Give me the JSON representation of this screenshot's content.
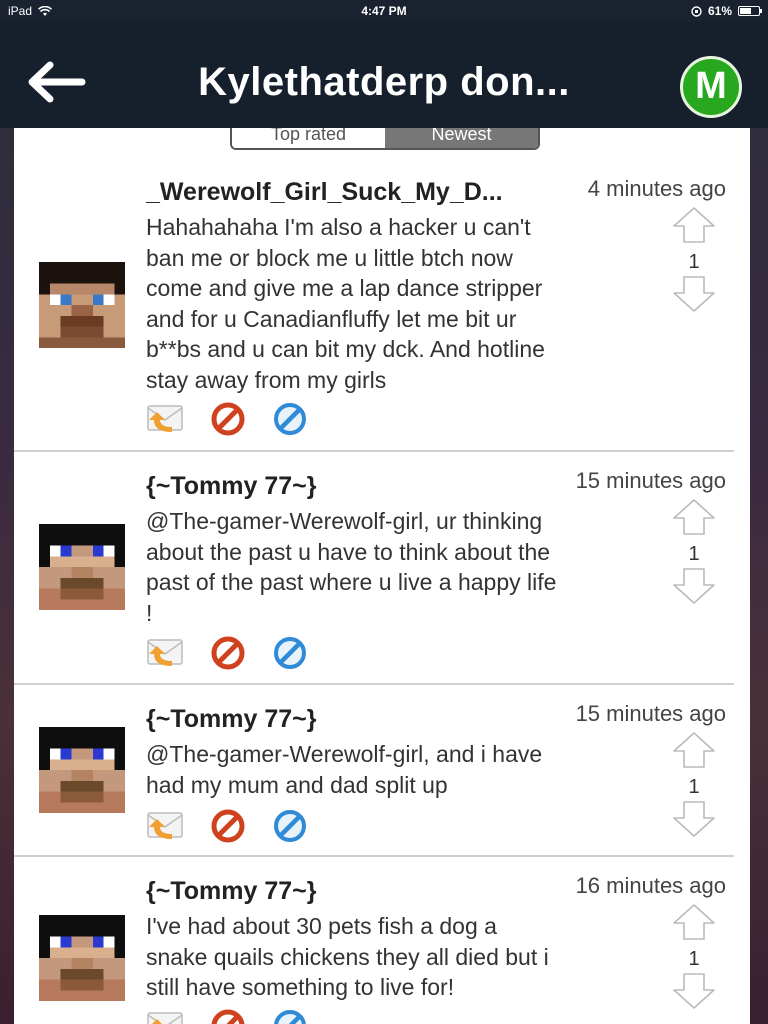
{
  "status": {
    "device": "iPad",
    "time": "4:47 PM",
    "battery": "61%"
  },
  "nav": {
    "title": "Kylethatderp don...",
    "logo_letter": "M"
  },
  "tabs": {
    "top_rated": "Top rated",
    "newest": "Newest"
  },
  "comments": [
    {
      "username": "_Werewolf_Girl_Suck_My_D...",
      "time": "4 minutes ago",
      "lines": [
        "Hahahahaha I'm also a hacker u can't",
        "ban me or block me u little btch now",
        "come and give me a lap dance stripper",
        "and for u Canadianfluffy let me bit ur",
        "b**bs and u can bit my dck. And hotline",
        "stay away from my girls"
      ],
      "votes": "1"
    },
    {
      "username": "{~Tommy 77~}",
      "time": "15 minutes ago",
      "lines": [
        "@The-gamer-Werewolf-girl, ur thinking",
        "about the past u have to think about the",
        "past of the past where u live a happy life",
        "!"
      ],
      "votes": "1"
    },
    {
      "username": "{~Tommy 77~}",
      "time": "15 minutes ago",
      "lines": [
        "@The-gamer-Werewolf-girl, and i have",
        "had my mum and dad split up"
      ],
      "votes": "1"
    },
    {
      "username": "{~Tommy 77~}",
      "time": "16 minutes ago",
      "lines": [
        "I've had about 30 pets fish a dog a",
        "snake quails chickens they all died but i",
        "still have something to live for!"
      ],
      "votes": "1"
    }
  ],
  "colors": {
    "nav_bg": "#16202c",
    "logo_green": "#27a81e",
    "reply_orange": "#f0a030",
    "block_red": "#d0421e",
    "report_blue": "#2f8ad8"
  }
}
